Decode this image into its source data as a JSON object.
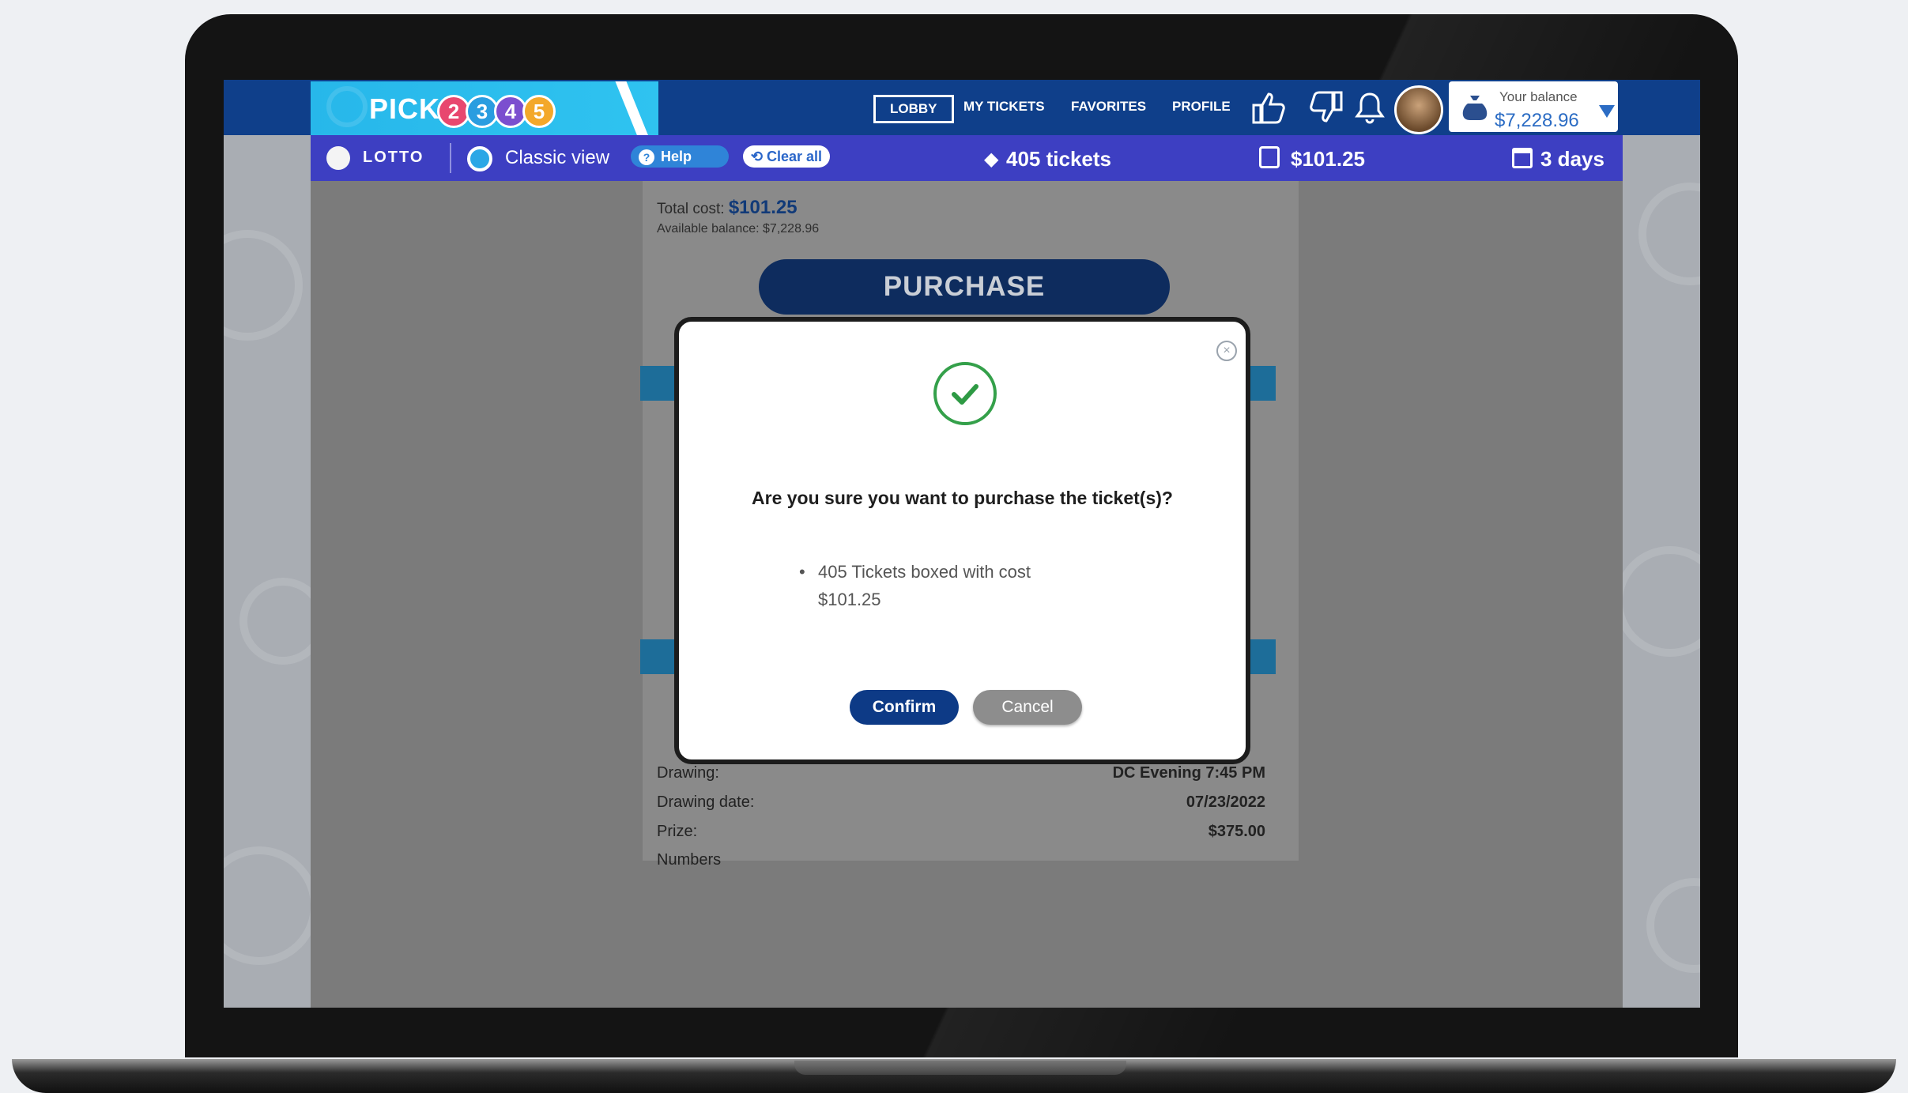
{
  "header": {
    "logo_text": "PICK",
    "logo_balls": [
      "2",
      "3",
      "4",
      "5"
    ],
    "nav": [
      {
        "label": "LOBBY",
        "active": true
      },
      {
        "label": "MY TICKETS",
        "active": false
      },
      {
        "label": "FAVORITES",
        "active": false
      },
      {
        "label": "PROFILE",
        "active": false
      }
    ],
    "icons": [
      "thumbs-up-icon",
      "thumbs-down-icon",
      "bell-icon"
    ],
    "balance_label": "Your balance",
    "balance_value": "$7,228.96"
  },
  "subbar": {
    "lotto_label": "LOTTO",
    "classic_view": "Classic view",
    "help": "Help",
    "clear_all": "Clear all",
    "tickets": "405 tickets",
    "cost": "$101.25",
    "days": "3 days"
  },
  "summary": {
    "total_cost_label": "Total cost:",
    "total_cost_value": "$101.25",
    "available_balance": "Available balance: $7,228.96",
    "purchase_button": "PURCHASE"
  },
  "details": [
    {
      "label": "Drawing:",
      "value": "DC Evening 7:45 PM"
    },
    {
      "label": "Drawing date:",
      "value": "07/23/2022"
    },
    {
      "label": "Prize:",
      "value": "$375.00"
    },
    {
      "label": "Numbers",
      "value": ""
    }
  ],
  "dialog": {
    "question": "Are you sure you want to purchase the ticket(s)?",
    "item": "405 Tickets boxed with cost $101.25",
    "confirm": "Confirm",
    "cancel": "Cancel"
  },
  "colors": {
    "primary": "#0d3a86",
    "success": "#34a04a",
    "subbar": "#3d3fc2",
    "logo_bg": "#2fc3f0"
  }
}
